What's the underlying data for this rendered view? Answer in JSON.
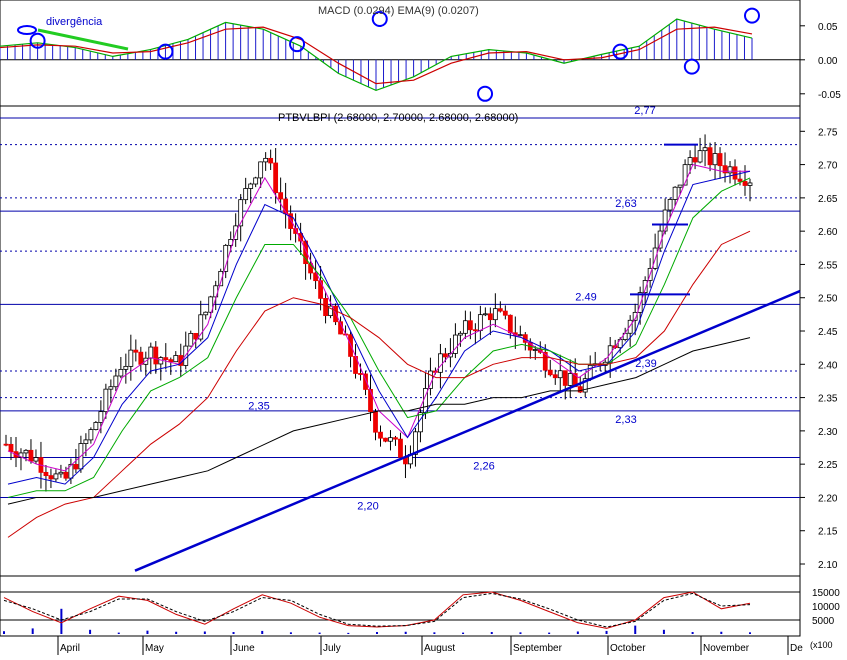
{
  "chart_data": [
    {
      "type": "line",
      "panel": "macd",
      "title_overlay": "MACD (0.0294) EMA(9) (0.0207)",
      "annotation": "divergência",
      "y_ticks": [
        0.05,
        0.0,
        -0.05
      ],
      "ylim": [
        -0.065,
        0.085
      ],
      "x": [
        0,
        10,
        20,
        30,
        40,
        50,
        60,
        70,
        80,
        90,
        100,
        110,
        120,
        130,
        140,
        150,
        160,
        170,
        180,
        190,
        200
      ],
      "series": [
        {
          "name": "MACD",
          "color": "#00aa00",
          "values": [
            0.02,
            0.025,
            0.018,
            0.005,
            0.015,
            0.03,
            0.055,
            0.045,
            0.02,
            -0.02,
            -0.045,
            -0.025,
            0.005,
            0.015,
            0.01,
            -0.005,
            0.008,
            0.02,
            0.06,
            0.045,
            0.032
          ]
        },
        {
          "name": "Signal",
          "color": "#cc0000",
          "values": [
            0.018,
            0.022,
            0.02,
            0.01,
            0.012,
            0.025,
            0.045,
            0.048,
            0.03,
            -0.005,
            -0.035,
            -0.03,
            -0.005,
            0.01,
            0.012,
            0.0,
            0.003,
            0.015,
            0.045,
            0.048,
            0.038
          ]
        }
      ],
      "markers": [
        {
          "x": 10,
          "y": 0.028
        },
        {
          "x": 44,
          "y": 0.012
        },
        {
          "x": 79,
          "y": 0.023
        },
        {
          "x": 101,
          "y": 0.06
        },
        {
          "x": 129,
          "y": -0.05
        },
        {
          "x": 165,
          "y": 0.012
        },
        {
          "x": 184,
          "y": -0.01
        },
        {
          "x": 215,
          "y": 0.065
        }
      ]
    },
    {
      "type": "candlestick",
      "panel": "price",
      "title": "PTBVLBPI (2.68000, 2.70000, 2.68000, 2.68000)",
      "y_ticks": [
        2.75,
        2.7,
        2.65,
        2.6,
        2.55,
        2.5,
        2.45,
        2.4,
        2.35,
        2.3,
        2.25,
        2.2,
        2.15,
        2.1
      ],
      "ylim": [
        2.085,
        2.785
      ],
      "x_labels": [
        "April",
        "May",
        "June",
        "July",
        "August",
        "September",
        "October",
        "November",
        "De"
      ],
      "close_series": [
        2.28,
        2.26,
        2.22,
        2.3,
        2.4,
        2.42,
        2.4,
        2.48,
        2.62,
        2.72,
        2.6,
        2.5,
        2.42,
        2.3,
        2.26,
        2.4,
        2.45,
        2.48,
        2.44,
        2.4,
        2.36,
        2.42,
        2.48,
        2.62,
        2.72,
        2.7,
        2.68
      ],
      "moving_averages": [
        {
          "name": "MA short",
          "color": "#cc00cc",
          "values": [
            2.27,
            2.25,
            2.24,
            2.28,
            2.38,
            2.41,
            2.4,
            2.46,
            2.6,
            2.68,
            2.61,
            2.52,
            2.43,
            2.33,
            2.29,
            2.39,
            2.44,
            2.46,
            2.44,
            2.41,
            2.38,
            2.41,
            2.47,
            2.6,
            2.7,
            2.69,
            2.69
          ]
        },
        {
          "name": "MA mid",
          "color": "#0000cc",
          "values": [
            2.22,
            2.23,
            2.22,
            2.26,
            2.34,
            2.39,
            2.4,
            2.44,
            2.55,
            2.64,
            2.62,
            2.54,
            2.45,
            2.36,
            2.29,
            2.35,
            2.42,
            2.45,
            2.44,
            2.42,
            2.39,
            2.4,
            2.45,
            2.57,
            2.67,
            2.68,
            2.69
          ]
        },
        {
          "name": "MA long",
          "color": "#00aa00",
          "values": [
            2.2,
            2.21,
            2.21,
            2.23,
            2.3,
            2.36,
            2.38,
            2.41,
            2.5,
            2.58,
            2.58,
            2.53,
            2.47,
            2.39,
            2.32,
            2.33,
            2.38,
            2.42,
            2.43,
            2.42,
            2.4,
            2.4,
            2.43,
            2.52,
            2.62,
            2.66,
            2.68
          ]
        },
        {
          "name": "MA slow",
          "color": "#cc0000",
          "values": [
            2.14,
            2.17,
            2.19,
            2.2,
            2.24,
            2.28,
            2.31,
            2.35,
            2.42,
            2.48,
            2.5,
            2.49,
            2.47,
            2.44,
            2.4,
            2.38,
            2.38,
            2.4,
            2.41,
            2.41,
            2.4,
            2.4,
            2.41,
            2.45,
            2.52,
            2.58,
            2.6
          ]
        },
        {
          "name": "MA 200",
          "color": "#000000",
          "values": [
            2.19,
            2.2,
            2.2,
            2.2,
            2.21,
            2.22,
            2.23,
            2.24,
            2.26,
            2.28,
            2.3,
            2.31,
            2.32,
            2.33,
            2.33,
            2.34,
            2.34,
            2.35,
            2.35,
            2.36,
            2.36,
            2.37,
            2.38,
            2.4,
            2.42,
            2.43,
            2.44
          ]
        }
      ],
      "support_resistance": [
        2.77,
        2.63,
        2.49,
        2.33,
        2.26,
        2.2
      ],
      "dashed_levels": [
        2.35,
        2.39,
        2.57,
        2.65,
        2.73
      ],
      "level_labels": [
        "2,77",
        "2,63",
        "2.49",
        "2,35",
        "2,39",
        "2,33",
        "2,26",
        "2,20"
      ],
      "trendline": {
        "from": [
          0,
          2.09
        ],
        "to": [
          26,
          2.51
        ]
      }
    },
    {
      "type": "line",
      "panel": "stochastic-volume",
      "y_ticks": [
        "15000",
        "10000",
        "5000"
      ],
      "unit_label": "(x100",
      "ylim": [
        0,
        20000
      ],
      "series": [
        {
          "name": "%K",
          "color": "#cc0000",
          "values": [
            13000,
            8000,
            4000,
            9000,
            13500,
            12000,
            7000,
            3500,
            9000,
            14000,
            11000,
            6000,
            3000,
            2500,
            3000,
            5000,
            14000,
            15000,
            12000,
            8000,
            4000,
            2000,
            5000,
            13000,
            15000,
            9000,
            11000
          ]
        },
        {
          "name": "%D",
          "color": "#000000",
          "values": [
            12000,
            9000,
            5000,
            8000,
            12500,
            12500,
            8000,
            4500,
            8000,
            13000,
            12000,
            7000,
            3500,
            2800,
            3000,
            4500,
            13000,
            14500,
            12500,
            9000,
            5000,
            2500,
            4500,
            12000,
            14500,
            10000,
            10500
          ]
        }
      ],
      "volume": [
        1000,
        2000,
        9000,
        1500,
        500,
        1200,
        800,
        900,
        700,
        1100,
        600,
        500,
        400,
        700,
        800,
        600,
        500,
        700,
        600,
        500,
        900,
        1100,
        3000,
        1500,
        700,
        800,
        600
      ]
    }
  ]
}
